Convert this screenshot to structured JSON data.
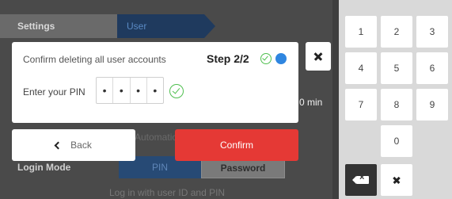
{
  "breadcrumb": {
    "settings": "Settings",
    "user_management": "User Management"
  },
  "background": {
    "min_value": "0 min",
    "automatic_text": "Automatic",
    "login_mode_label": "Login Mode",
    "pin_option": "PIN",
    "password_option": "Password",
    "hint_text": "Log in with user ID and PIN"
  },
  "dialog": {
    "message": "Confirm deleting all user accounts",
    "step": "Step 2/2",
    "pin_label": "Enter your PIN",
    "pin_digits": [
      "•",
      "•",
      "•",
      "•"
    ],
    "back_label": "Back",
    "confirm_label": "Confirm"
  },
  "keypad": {
    "keys": [
      "1",
      "2",
      "3",
      "4",
      "5",
      "6",
      "7",
      "8",
      "9",
      "0"
    ]
  },
  "colors": {
    "confirm": "#e53935",
    "step_active": "#2f86e0",
    "check": "#4fbf4f"
  },
  "icons": {
    "step_done": "check-circle-icon",
    "step_active": "blue-dot-icon",
    "pin_valid": "check-circle-icon",
    "close": "close-icon",
    "back": "chevron-left-icon",
    "backspace": "backspace-icon",
    "clear": "clear-icon"
  }
}
